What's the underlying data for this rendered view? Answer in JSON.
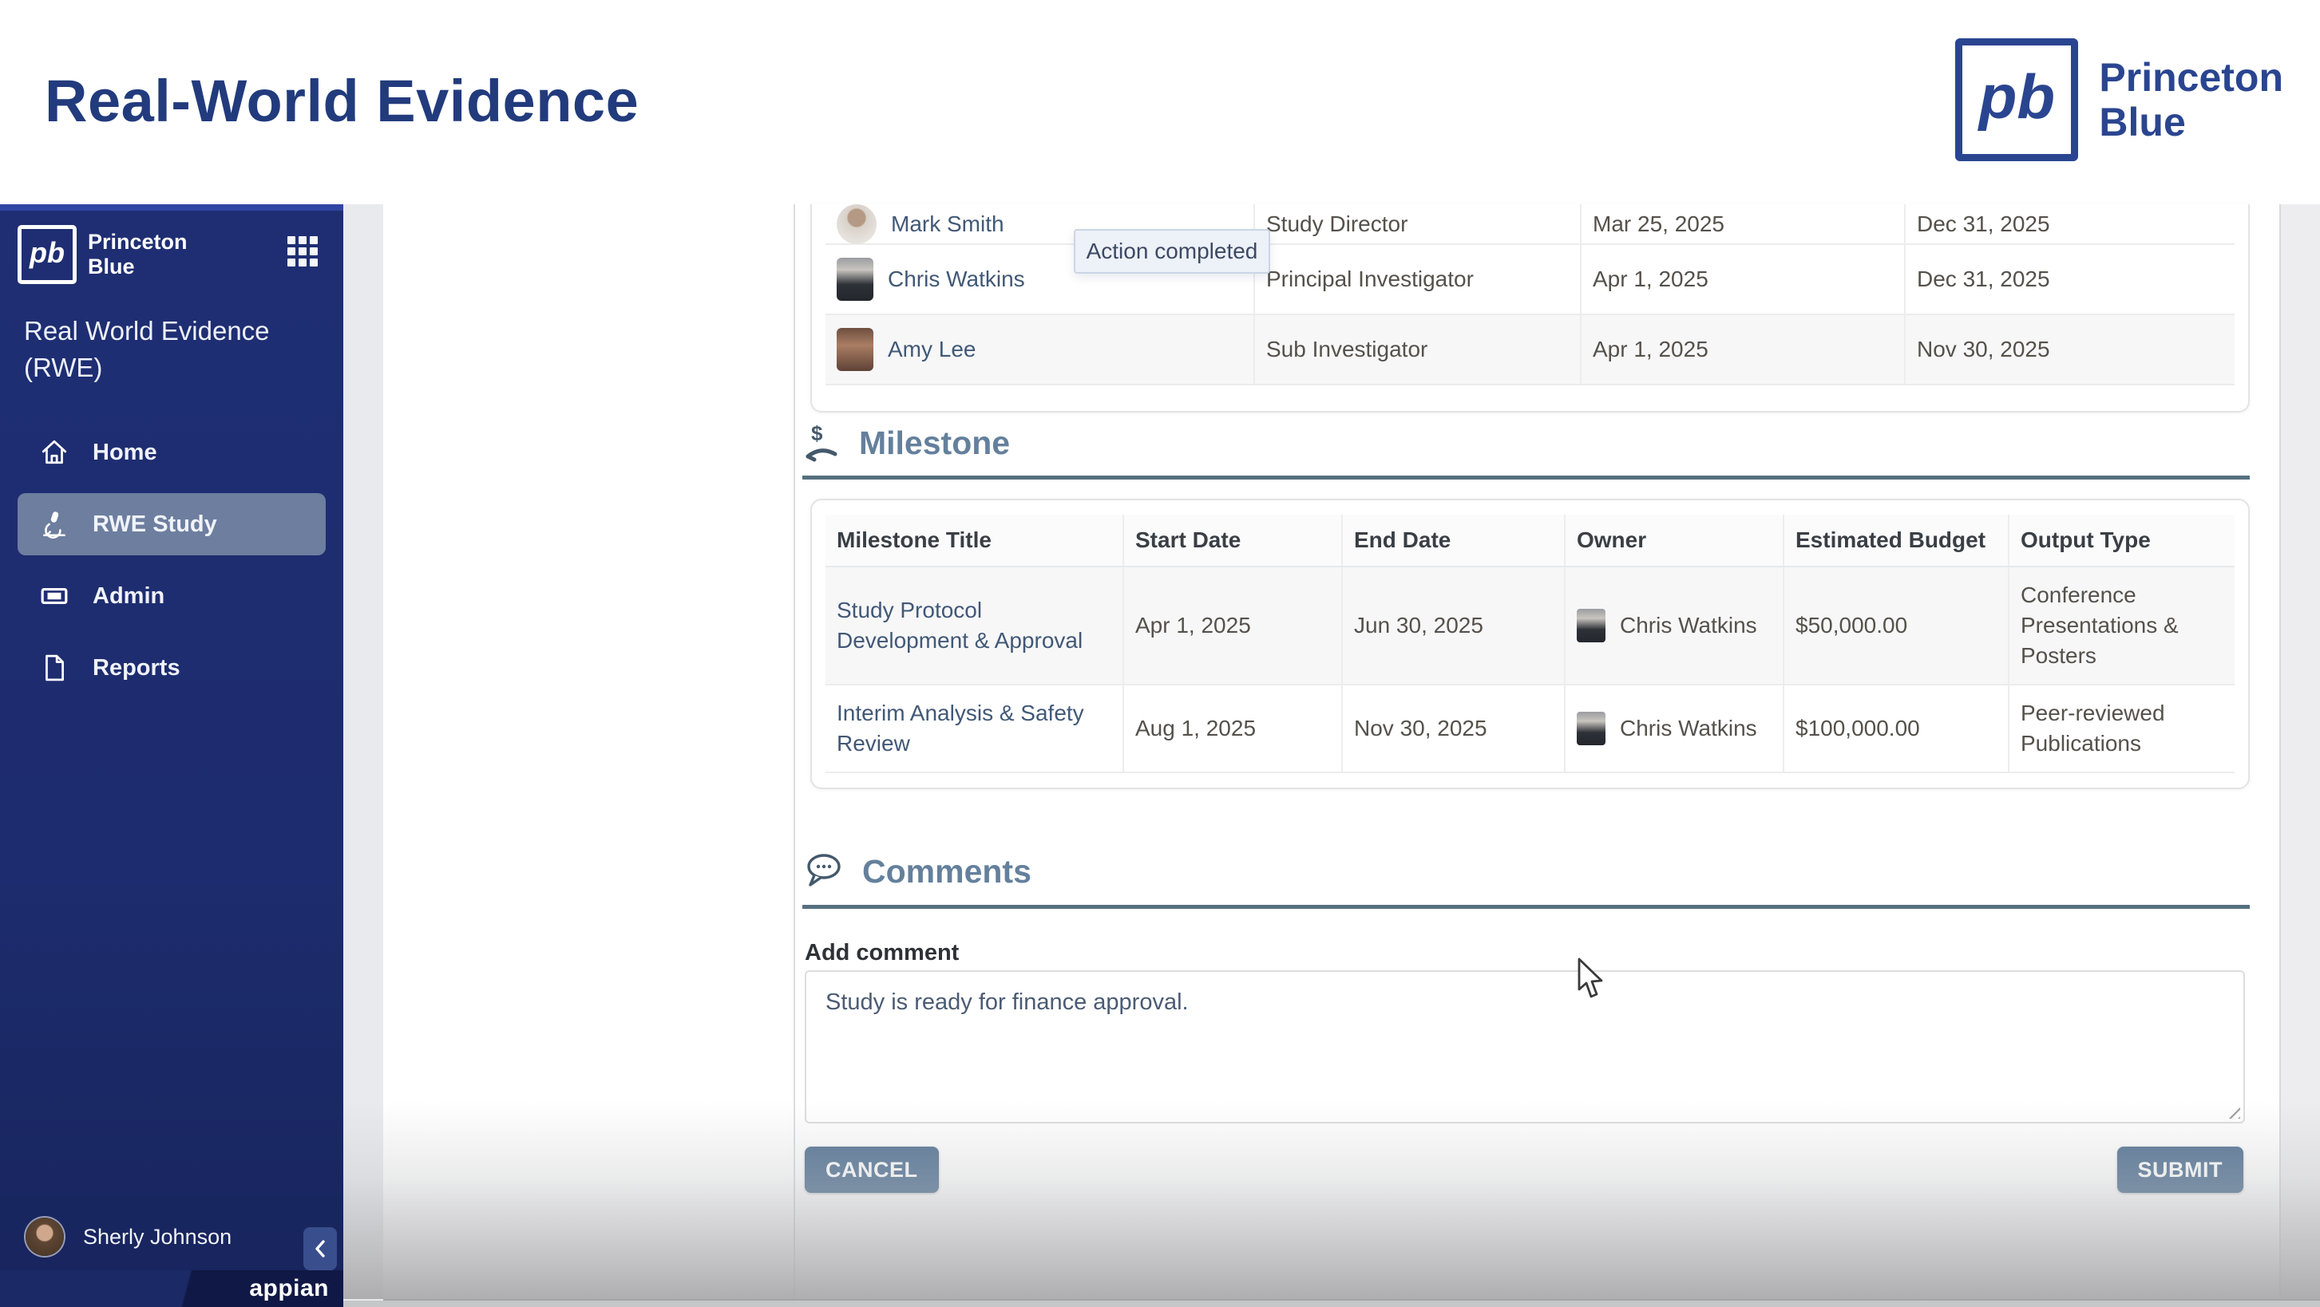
{
  "header": {
    "title": "Real-World Evidence",
    "brand": {
      "monogram": "pb",
      "line1": "Princeton",
      "line2": "Blue"
    }
  },
  "sidebar": {
    "brand": {
      "monogram": "pb",
      "line1": "Princeton",
      "line2": "Blue"
    },
    "app_title_line1": "Real World Evidence",
    "app_title_line2": "(RWE)",
    "nav": [
      {
        "label": "Home",
        "icon": "home-icon",
        "active": false
      },
      {
        "label": "RWE Study",
        "icon": "microscope-icon",
        "active": true
      },
      {
        "label": "Admin",
        "icon": "card-icon",
        "active": false
      },
      {
        "label": "Reports",
        "icon": "document-icon",
        "active": false
      }
    ],
    "user": {
      "name": "Sherly Johnson"
    },
    "collapse_icon": "chevron-left-icon",
    "apps_icon": "grid-icon",
    "platform_brand": "appian"
  },
  "tooltip": {
    "text": "Action completed"
  },
  "people_table": {
    "rows": [
      {
        "name": "Mark Smith",
        "role": "Study Director",
        "start_date": "Mar 25, 2025",
        "end_date": "Dec 31, 2025"
      },
      {
        "name": "Chris Watkins",
        "role": "Principal Investigator",
        "start_date": "Apr 1, 2025",
        "end_date": "Dec 31, 2025"
      },
      {
        "name": "Amy Lee",
        "role": "Sub Investigator",
        "start_date": "Apr 1, 2025",
        "end_date": "Nov 30, 2025"
      }
    ]
  },
  "milestone": {
    "section_title": "Milestone",
    "icon": "hand-dollar-icon",
    "columns": [
      "Milestone Title",
      "Start Date",
      "End Date",
      "Owner",
      "Estimated Budget",
      "Output Type"
    ],
    "rows": [
      {
        "title": "Study Protocol Development & Approval",
        "start_date": "Apr 1, 2025",
        "end_date": "Jun 30, 2025",
        "owner": "Chris Watkins",
        "budget": "$50,000.00",
        "output_type": "Conference Presentations & Posters"
      },
      {
        "title": "Interim Analysis & Safety Review",
        "start_date": "Aug 1, 2025",
        "end_date": "Nov 30, 2025",
        "owner": "Chris Watkins",
        "budget": "$100,000.00",
        "output_type": "Peer-reviewed Publications"
      }
    ]
  },
  "comments": {
    "section_title": "Comments",
    "icon": "speech-bubble-icon",
    "add_label": "Add comment",
    "value": "Study is ready for finance approval."
  },
  "actions": {
    "cancel": "CANCEL",
    "submit": "SUBMIT"
  },
  "colors": {
    "sidebar_navy": "#1d2c6e",
    "brand_navy": "#2a4590",
    "title_navy": "#223b7d",
    "active_nav": "#6d7e9f",
    "section_header": "#64809c",
    "section_divider": "#56707f",
    "button": "#567595",
    "tooltip_bg": "#edf1f8"
  }
}
